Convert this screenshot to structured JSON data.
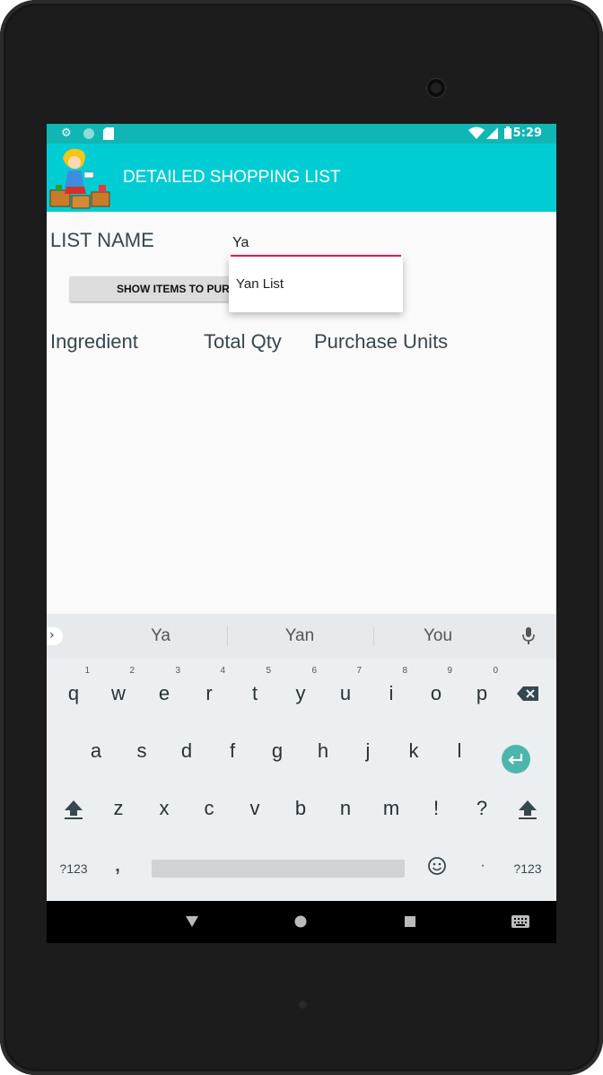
{
  "status_bar": {
    "time": "5:29",
    "left_icons": [
      "gear-icon",
      "circle-icon",
      "sd-card-icon"
    ],
    "right_icons": [
      "wifi-icon",
      "signal-icon",
      "battery-icon"
    ]
  },
  "app": {
    "title": "DETAILED SHOPPING LIST",
    "accent_color": "#00cdd3"
  },
  "form": {
    "list_name_label": "LIST NAME",
    "list_name_value": "Ya",
    "show_button_label": "SHOW ITEMS TO PURCHASE",
    "dropdown_options": [
      "Yan List"
    ]
  },
  "columns": [
    "Ingredient",
    "Total Qty",
    "Purchase Units"
  ],
  "keyboard": {
    "suggestions": [
      "Ya",
      "Yan",
      "You"
    ],
    "row1": [
      "q",
      "w",
      "e",
      "r",
      "t",
      "y",
      "u",
      "i",
      "o",
      "p"
    ],
    "row1_hints": [
      "1",
      "2",
      "3",
      "4",
      "5",
      "6",
      "7",
      "8",
      "9",
      "0"
    ],
    "row2": [
      "a",
      "s",
      "d",
      "f",
      "g",
      "h",
      "j",
      "k",
      "l"
    ],
    "row3": [
      "z",
      "x",
      "c",
      "v",
      "b",
      "n",
      "m",
      "!",
      "?"
    ],
    "sym_label": "?123",
    "comma": ",",
    "period": "·"
  }
}
